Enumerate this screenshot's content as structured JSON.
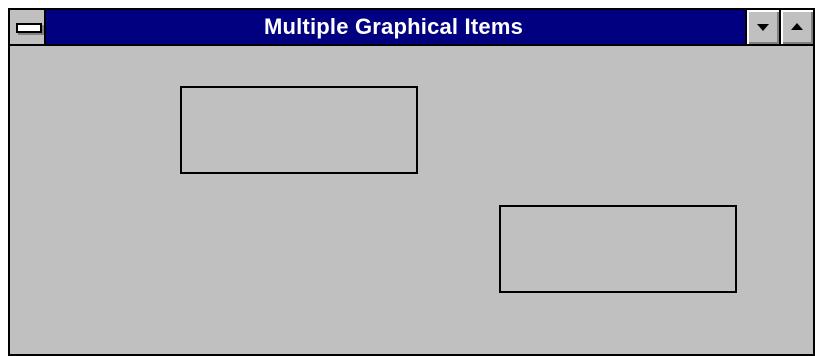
{
  "window": {
    "title": "Multiple Graphical Items",
    "title_bar_color": "#000080",
    "background_color": "#c0c0c0"
  },
  "controls": {
    "system_menu_icon": "system-menu-icon",
    "minimize_icon": "minimize-arrow-icon",
    "maximize_icon": "maximize-arrow-icon"
  },
  "graphical_items": [
    {
      "shape": "rectangle",
      "fill": "none",
      "stroke": "#000000"
    },
    {
      "shape": "rectangle",
      "fill": "none",
      "stroke": "#000000"
    }
  ]
}
